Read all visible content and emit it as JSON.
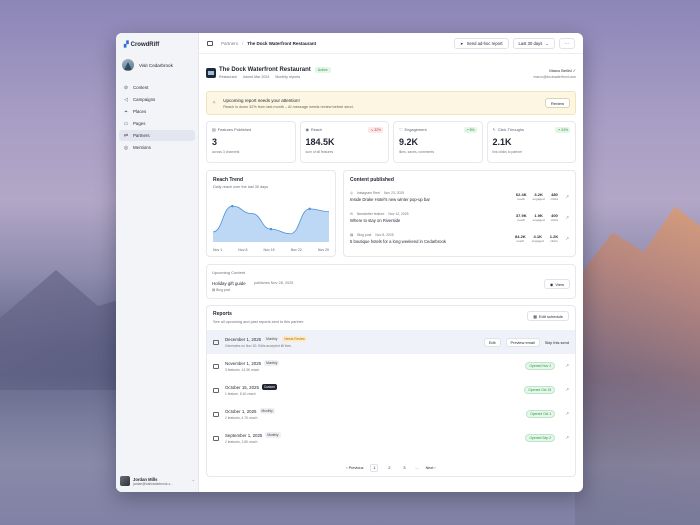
{
  "app": {
    "brand": "CrowdRiff",
    "org_name": "Visit Cedarbrook"
  },
  "sidebar": {
    "items": [
      {
        "label": "Content",
        "icon": "content-icon",
        "glyph": "⊘"
      },
      {
        "label": "Campaigns",
        "icon": "megaphone-icon",
        "glyph": "◁"
      },
      {
        "label": "Places",
        "icon": "pin-icon",
        "glyph": "⌖"
      },
      {
        "label": "Pages",
        "icon": "page-icon",
        "glyph": "▭"
      },
      {
        "label": "Partners",
        "icon": "handshake-icon",
        "glyph": "⇄",
        "active": true
      },
      {
        "label": "Mentions",
        "icon": "at-icon",
        "glyph": "◎"
      }
    ],
    "user": {
      "name": "Jordan Mills",
      "email": "jordan@visitcedarbrook.c..."
    }
  },
  "topbar": {
    "breadcrumb_parent": "Partners",
    "breadcrumb_current": "The Dock Waterfront Restaurant",
    "send_label": "Send ad-hoc report",
    "range_label": "Last 30 days",
    "more_label": "···"
  },
  "partner": {
    "name": "The Dock Waterfront Restaurant",
    "status": "Active",
    "type": "Restaurant",
    "joined": "Joined Mar 2024",
    "cadence": "Monthly reports",
    "contact_name": "Marco Bellini",
    "contact_email": "marco@dockwaterfront.com"
  },
  "alert": {
    "title": "Upcoming report needs your attention!",
    "body": "Reach is down 32% from last month – AI message needs review before send.",
    "button": "Review"
  },
  "stats": [
    {
      "label": "Features Published",
      "value": "3",
      "sub": "across 3 channels",
      "delta": ""
    },
    {
      "label": "Reach",
      "value": "184.5K",
      "sub": "sum of all features",
      "delta": "↘ 32%",
      "delta_kind": "neg"
    },
    {
      "label": "Engagement",
      "value": "9.2K",
      "sub": "likes, saves, comments",
      "delta": "↗ 8%",
      "delta_kind": "pos"
    },
    {
      "label": "Click-Throughs",
      "value": "2.1K",
      "sub": "link clicks to partner",
      "delta": "↗ 24%",
      "delta_kind": "pos"
    }
  ],
  "trend": {
    "title": "Reach Trend",
    "subtitle": "Daily reach over the last 30 days",
    "ticks": [
      "Nov 1",
      "Nov 8",
      "Nov 15",
      "Nov 22",
      "Nov 29"
    ],
    "fill_color": "#bcd8f4",
    "line_color": "#4f8fd8"
  },
  "chart_data": {
    "type": "area",
    "title": "Reach Trend",
    "subtitle": "Daily reach over the last 30 days",
    "x": [
      "Nov 1",
      "Nov 4",
      "Nov 8",
      "Nov 15",
      "Nov 20",
      "Nov 24",
      "Nov 29"
    ],
    "values": [
      0.22,
      0.78,
      0.62,
      0.28,
      0.18,
      0.72,
      0.66
    ],
    "ylim": [
      0,
      1
    ],
    "grid": false
  },
  "published": {
    "title": "Content published",
    "rows": [
      {
        "source": "Instagram Reel",
        "date": "Nov 23, 2025",
        "title": "Inside Drake Hotel's new winter pop-up bar",
        "reach": "62.4K",
        "engaged": "3.2K",
        "clicks": "480"
      },
      {
        "source": "Newsletter feature",
        "date": "Nov 12, 2025",
        "title": "Where to stay on Riverside",
        "reach": "37.9K",
        "engaged": "1.9K",
        "clicks": "400"
      },
      {
        "source": "Blog post",
        "date": "Nov 8, 2025",
        "title": "5 boutique hotels for a long weekend in Cedarbrook",
        "reach": "84.2K",
        "engaged": "4.1K",
        "clicks": "1.2K"
      }
    ],
    "lbl_reach": "reach",
    "lbl_engaged": "engaged",
    "lbl_clicks": "clicks"
  },
  "upcoming": {
    "heading": "Upcoming Content",
    "title": "Holiday gift guide",
    "published": "publishes Nov 28, 2025",
    "type": "Blog post",
    "button": "View"
  },
  "reports": {
    "title": "Reports",
    "subtitle": "See all upcoming and past reports sent to this partner.",
    "edit_label": "Edit schedule",
    "rows": [
      {
        "date": "December 1, 2025",
        "tag": "Monthly",
        "tag2": "Needs Review",
        "detail": "Generates on Nov 30. Edits accepted till then.",
        "upcoming": true,
        "edit": "Edit",
        "preview": "Preview email",
        "skip": "Skip this send"
      },
      {
        "date": "November 1, 2025",
        "tag": "Monthly",
        "detail": "3 features, 14.3K reach",
        "opened": "Opened Nov 2"
      },
      {
        "date": "October 15, 2025",
        "tag": "Custom",
        "tag_kind": "custom",
        "detail": "1 feature, 8.1K reach",
        "opened": "Opened Oct 15"
      },
      {
        "date": "October 1, 2025",
        "tag": "Monthly",
        "detail": "2 features, 4.7K reach",
        "opened": "Opened Oct 1"
      },
      {
        "date": "September 1, 2025",
        "tag": "Monthly",
        "detail": "2 features, 2.8K reach",
        "opened": "Opened Sep 2"
      }
    ],
    "pager": {
      "prev": "‹ Previous",
      "pages": [
        "1",
        "2",
        "3"
      ],
      "ellipsis": "...",
      "next": "Next ›",
      "current": "1"
    }
  }
}
